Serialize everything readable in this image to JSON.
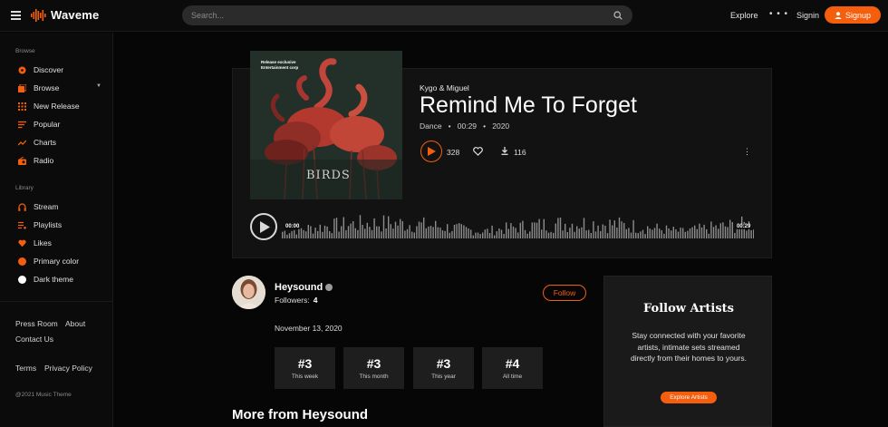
{
  "app": {
    "name": "Waveme"
  },
  "colors": {
    "accent": "#f45e0d",
    "background": "#060606",
    "panel": "#121212"
  },
  "header": {
    "search_placeholder": "Search...",
    "explore_label": "Explore",
    "more_label": "• • •",
    "signin_label": "Signin",
    "signup_label": "Signup"
  },
  "sidebar": {
    "browse_label": "Browse",
    "browse_items": [
      {
        "label": "Discover",
        "icon": "disc-icon"
      },
      {
        "label": "Browse",
        "icon": "browse-icon"
      },
      {
        "label": "New Release",
        "icon": "grid-icon"
      },
      {
        "label": "Popular",
        "icon": "popular-icon"
      },
      {
        "label": "Charts",
        "icon": "chart-icon"
      },
      {
        "label": "Radio",
        "icon": "radio-icon"
      }
    ],
    "library_label": "Library",
    "library_items": [
      {
        "label": "Stream",
        "icon": "headphones-icon"
      },
      {
        "label": "Playlists",
        "icon": "playlist-icon"
      },
      {
        "label": "Likes",
        "icon": "heart-icon"
      },
      {
        "label": "Primary color",
        "icon": "orange-swatch-icon"
      },
      {
        "label": "Dark theme",
        "icon": "white-swatch-icon"
      }
    ],
    "footer_links": {
      "press_room": "Press Room",
      "about": "About",
      "contact": "Contact Us",
      "terms": "Terms",
      "privacy": "Privacy Policy"
    },
    "copyright": "@2021 Music Theme"
  },
  "track": {
    "artist": "Kygo & Miguel",
    "title": "Remind Me To Forget",
    "genre": "Dance",
    "duration": "00:29",
    "year": "2020",
    "plays": "328",
    "downloads": "116",
    "time_start": "00:00",
    "time_end": "00:29",
    "cover_tag": "Release exclusive\nEntertainment corp",
    "cover_title": "BIRDS"
  },
  "artist": {
    "name": "Heysound",
    "followers_label": "Followers:",
    "followers_count": "4",
    "follow_label": "Follow",
    "date": "November 13, 2020"
  },
  "ranks": [
    {
      "value": "#3",
      "label": "This week"
    },
    {
      "value": "#3",
      "label": "This month"
    },
    {
      "value": "#3",
      "label": "This year"
    },
    {
      "value": "#4",
      "label": "All time"
    }
  ],
  "more_from": "More from Heysound",
  "follow_panel": {
    "title": "Follow Artists",
    "text": "Stay connected with your favorite artists, intimate sets streamed directly from their homes to yours.",
    "button": "Explore Artists"
  }
}
